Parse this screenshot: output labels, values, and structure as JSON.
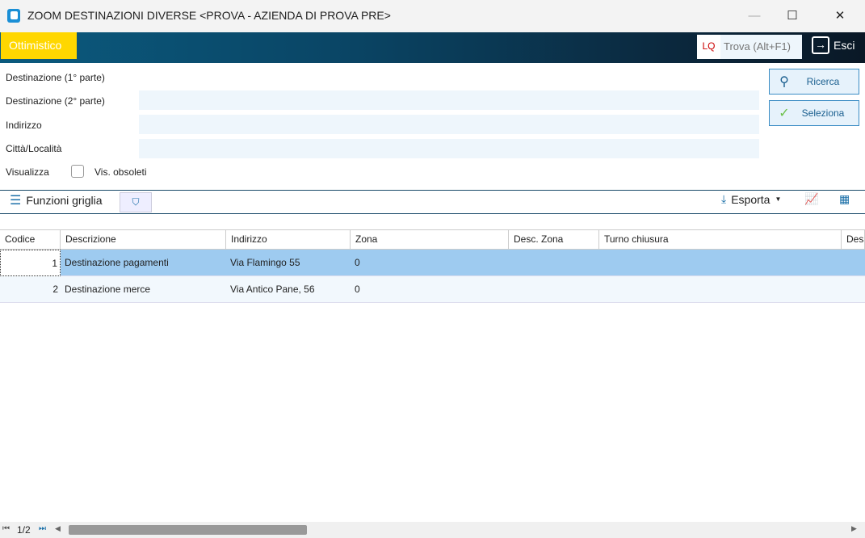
{
  "window": {
    "title": "ZOOM DESTINAZIONI DIVERSE <PROVA - AZIENDA DI PROVA PRE>",
    "minimize": "—",
    "maximize": "☐",
    "close": "✕"
  },
  "header": {
    "profile": "Ottimistico",
    "lq": "LQ",
    "search_placeholder": "Trova (Alt+F1)",
    "exit": "Esci"
  },
  "form": {
    "dest1": "Destinazione (1° parte)",
    "dest2": "Destinazione (2° parte)",
    "indirizzo": "Indirizzo",
    "citta": "Città/Località",
    "visualizza": "Visualizza",
    "obsoleti": "Vis. obsoleti",
    "ricerca": "Ricerca",
    "seleziona": "Seleziona"
  },
  "toolbar": {
    "funzioni": "Funzioni griglia",
    "esporta": "Esporta"
  },
  "table": {
    "columns": [
      "Codice",
      "Descrizione",
      "Indirizzo",
      "Zona",
      "Desc. Zona",
      "Turno chiusura",
      "Des"
    ],
    "rows": [
      {
        "codice": "1",
        "descrizione": "Destinazione pagamenti",
        "indirizzo": "Via Flamingo 55",
        "zona": "0",
        "selected": true
      },
      {
        "codice": "2",
        "descrizione": "Destinazione merce",
        "indirizzo": "Via Antico Pane, 56",
        "zona": "0",
        "selected": false
      }
    ]
  },
  "pager": {
    "page": "1/2"
  },
  "colors": {
    "accent": "#ffd700",
    "selected_row": "#9ecbf0",
    "input_bg": "#eef6fc"
  }
}
